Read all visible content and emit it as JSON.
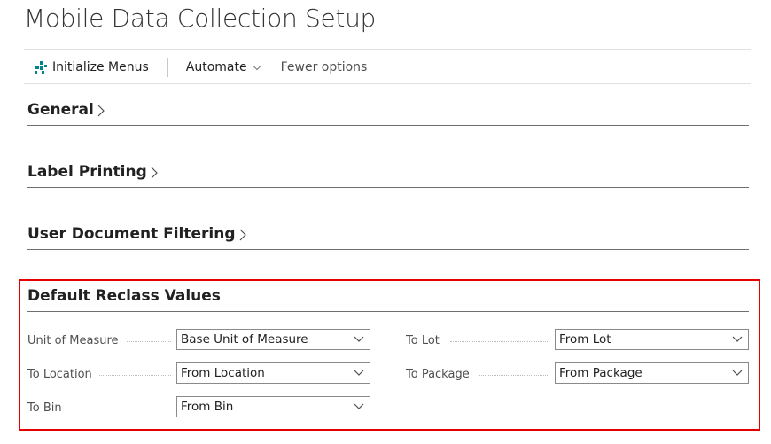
{
  "page": {
    "title": "Mobile Data Collection Setup"
  },
  "toolbar": {
    "initialize_label": "Initialize Menus",
    "automate_label": "Automate",
    "fewer_label": "Fewer options"
  },
  "sections": {
    "general": "General",
    "label_printing": "Label Printing",
    "user_doc_filtering": "User Document Filtering",
    "default_reclass": "Default Reclass Values"
  },
  "fields": {
    "unit_of_measure": {
      "label": "Unit of Measure",
      "value": "Base Unit of Measure"
    },
    "to_location": {
      "label": "To Location",
      "value": "From Location"
    },
    "to_bin": {
      "label": "To Bin",
      "value": "From Bin"
    },
    "to_lot": {
      "label": "To Lot",
      "value": "From Lot"
    },
    "to_package": {
      "label": "To Package",
      "value": "From Package"
    }
  },
  "colors": {
    "highlight": "#e60000",
    "accent": "#008489"
  }
}
